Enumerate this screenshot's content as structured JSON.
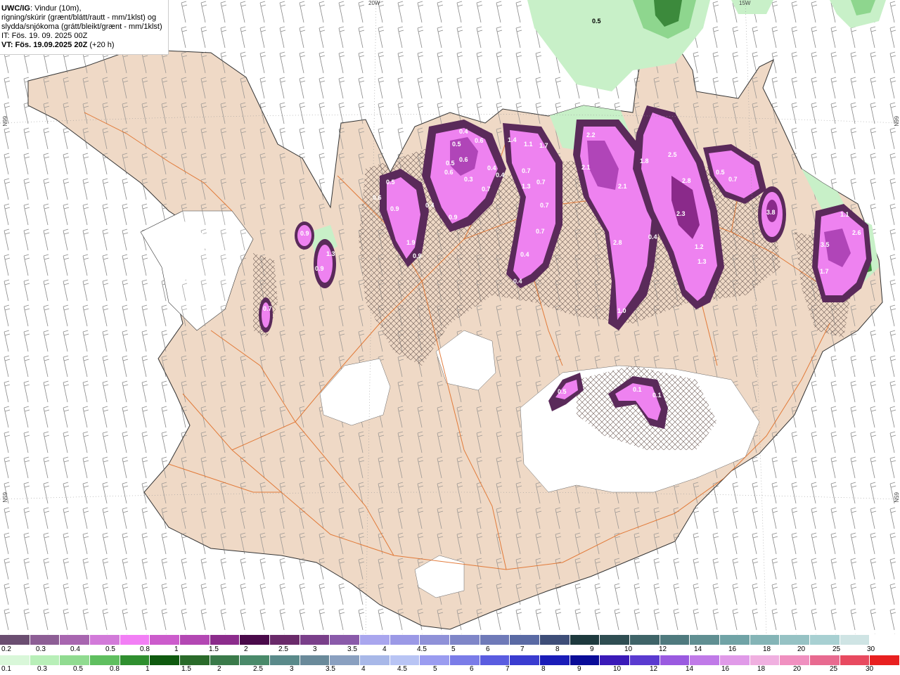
{
  "title": {
    "model": "UWC/IG",
    "line1": ": Vindur (10m),",
    "line2": "rigning/skúrir (grænt/blátt/rautt - mm/1klst) og",
    "line3": "slydda/snjókoma (grátt/bleikt/grænt - mm/1klst)",
    "it": "IT: Fös. 19. 09. 2025 00Z",
    "vt": "VT: Fös. 19.09.2025 20Z",
    "vt_suffix": "(+20 h)"
  },
  "grid_labels": {
    "lon_20w": "20W",
    "lon_15w": "15W",
    "lat_66n_left": "66N",
    "lat_66n_right": "66N",
    "lat_65n_left": "65N",
    "lat_65n_right": "65N"
  },
  "precip_values": {
    "v1": "0.5",
    "v2": "0.4",
    "v3": "0.5",
    "v4": "0.6",
    "v5": "0.6",
    "v6": "0.6",
    "v7": "0.3",
    "v8": "1.4",
    "v9": "1.1",
    "v10": "1.7",
    "v11": "0.4",
    "v12": "0.4",
    "v13": "0.7",
    "v14": "0.7",
    "v15": "1.3",
    "v16": "0.7",
    "v17": "0.7",
    "v18": "0.7",
    "v19": "0.4",
    "v20": "0.4",
    "v21": "0.5",
    "v22": "0.6",
    "v23": "0.9",
    "v24": "0.4",
    "v25": "0.9",
    "v26": "1.9",
    "v27": "0.9",
    "v28": "0.9",
    "v29": "0.9",
    "v30": "1.3",
    "v31": "0.7",
    "v32": "2.2",
    "v33": "2.1",
    "v34": "2.1",
    "v35": "1.8",
    "v36": "2.5",
    "v37": "2.8",
    "v38": "2.3",
    "v39": "2.8",
    "v40": "0.4",
    "v41": "1.2",
    "v42": "1.3",
    "v43": "1.0",
    "v44": "0.5",
    "v45": "0.7",
    "v46": "3.8",
    "v47": "3.5",
    "v48": "1.7",
    "v49": "2.6",
    "v50": "1.1",
    "v51": "0.5",
    "v52": "0.1",
    "v53": "0.1",
    "v54": "0.5"
  },
  "legend_snow": {
    "colors": [
      "#6b4e71",
      "#8d5e95",
      "#a866b0",
      "#d27ad9",
      "#f27ff5",
      "#cc5ccc",
      "#b347b3",
      "#8c2c8c",
      "#4a0a4a",
      "#6a2a6a",
      "#7a3f8a",
      "#8a5aaa",
      "#a9a6ee",
      "#9b99e6",
      "#8f91d8",
      "#7f86c8",
      "#6f7ab8",
      "#5a6aa4",
      "#3e4e78",
      "#1e3a3e",
      "#2f4e52",
      "#3f6468",
      "#4f7a7e",
      "#608f92",
      "#70a3a6",
      "#84b4b6",
      "#96c2c4",
      "#a8d0d2",
      "#cfe4e4",
      "#ffffff"
    ],
    "labels": [
      "0.2",
      "0.3",
      "0.4",
      "0.5",
      "0.8",
      "1",
      "1.5",
      "2",
      "2.5",
      "3",
      "3.5",
      "4",
      "4.5",
      "5",
      "6",
      "7",
      "8",
      "9",
      "10",
      "12",
      "14",
      "16",
      "18",
      "20",
      "25",
      "30"
    ]
  },
  "legend_rain": {
    "colors": [
      "#d9f7d9",
      "#b8efb8",
      "#90db90",
      "#5fbf5f",
      "#2f8f2f",
      "#0f5a0f",
      "#2a6a2a",
      "#3a7a4a",
      "#4a8a6a",
      "#5a8a8a",
      "#6a8a9a",
      "#8aa0c0",
      "#a8b8e8",
      "#b8c4f4",
      "#9a9cf0",
      "#7a7ce8",
      "#5a5ce0",
      "#3a3cd0",
      "#1a1cb8",
      "#0a0c98",
      "#3a1ab8",
      "#5a3ad0",
      "#9a5ae0",
      "#c07ae8",
      "#e09ae8",
      "#f0b0e0",
      "#f090c0",
      "#e86a90",
      "#e84a60",
      "#e82020"
    ],
    "labels": [
      "0.1",
      "0.3",
      "0.5",
      "0.8",
      "1",
      "1.5",
      "2",
      "2.5",
      "3",
      "3.5",
      "4",
      "4.5",
      "5",
      "6",
      "7",
      "8",
      "9",
      "10",
      "12",
      "14",
      "16",
      "18",
      "20",
      "25",
      "30"
    ]
  },
  "colors": {
    "land": "#efd9c6",
    "glacier": "#ffffff",
    "road": "#e0702a",
    "rain_light": "#c8f0c8",
    "rain_mid": "#8ed68e",
    "rain_dark": "#3c8a3c",
    "snow_dark": "#5a2a5a",
    "snow_mid": "#b045b8",
    "snow_light": "#ee82f0"
  }
}
